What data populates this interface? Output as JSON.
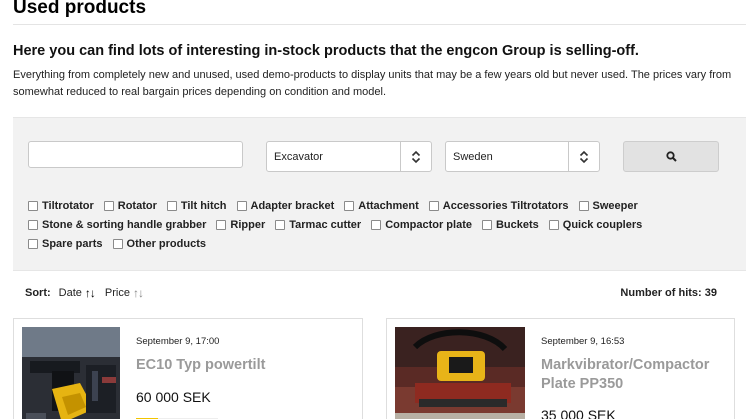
{
  "page": {
    "title": "Used products",
    "headline": "Here you can find lots of interesting in-stock products that the engcon Group is selling-off.",
    "intro": "Everything from completely new and unused, used demo-products to display units that may be a few years old but never used. The prices vary from somewhat reduced to real bargain prices depending on condition and model."
  },
  "filters": {
    "search": {
      "value": "",
      "placeholder": ""
    },
    "type_select": {
      "value": "Excavator"
    },
    "country_select": {
      "value": "Sweden"
    },
    "search_button_icon": "search-icon",
    "categories": [
      "Tiltrotator",
      "Rotator",
      "Tilt hitch",
      "Adapter bracket",
      "Attachment",
      "Accessories Tiltrotators",
      "Sweeper",
      "Stone & sorting handle grabber",
      "Ripper",
      "Tarmac cutter",
      "Compactor plate",
      "Buckets",
      "Quick couplers",
      "Spare parts",
      "Other products"
    ]
  },
  "sort": {
    "label": "Sort:",
    "options": [
      {
        "label": "Date",
        "arrows": "↑↓"
      },
      {
        "label": "Price",
        "arrows": "↑↓"
      }
    ]
  },
  "hits": {
    "text": "Number of hits: 39"
  },
  "products": [
    {
      "date": "September 9, 17:00",
      "title": "EC10 Typ powertilt",
      "price": "60 000 SEK"
    },
    {
      "date": "September 9, 16:53",
      "title": "Markvibrator/Compactor Plate PP350",
      "price": "35 000 SEK"
    }
  ],
  "colors": {
    "panel_bg": "#f2f2f2",
    "title_grey": "#9a9a9a",
    "accent_yellow": "#f2c500"
  }
}
